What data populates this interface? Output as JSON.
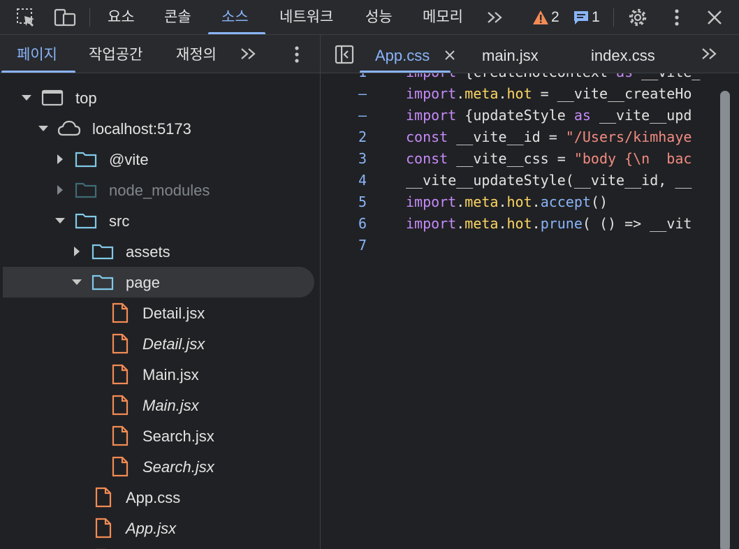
{
  "toolbar": {
    "tabs": [
      "요소",
      "콘솔",
      "소스",
      "네트워크",
      "성능",
      "메모리"
    ],
    "active_tab": "소스",
    "more_icon": "chevron-double-right",
    "warning_count": "2",
    "message_count": "1",
    "colors": {
      "accent": "#8ab4f8",
      "warning": "#f28b54"
    }
  },
  "navigator": {
    "tabs": [
      "페이지",
      "작업공간",
      "재정의"
    ],
    "active_tab": "페이지",
    "tree": [
      {
        "label": "top",
        "type": "frame",
        "expanded": true
      },
      {
        "label": "localhost:5173",
        "type": "cloud",
        "expanded": true
      },
      {
        "label": "@vite",
        "type": "folder",
        "expanded": false
      },
      {
        "label": "node_modules",
        "type": "folder",
        "expanded": false,
        "dimmed": true
      },
      {
        "label": "src",
        "type": "folder",
        "expanded": true
      },
      {
        "label": "assets",
        "type": "folder",
        "expanded": false
      },
      {
        "label": "page",
        "type": "folder",
        "expanded": true,
        "selected": true
      },
      {
        "label": "Detail.jsx",
        "type": "file"
      },
      {
        "label": "Detail.jsx",
        "type": "file",
        "italic": true
      },
      {
        "label": "Main.jsx",
        "type": "file"
      },
      {
        "label": "Main.jsx",
        "type": "file",
        "italic": true
      },
      {
        "label": "Search.jsx",
        "type": "file"
      },
      {
        "label": "Search.jsx",
        "type": "file",
        "italic": true
      },
      {
        "label": "App.css",
        "type": "file"
      },
      {
        "label": "App.jsx",
        "type": "file",
        "italic": true
      }
    ]
  },
  "editor": {
    "tabs": [
      "App.css",
      "main.jsx",
      "index.css"
    ],
    "active_tab": "App.css",
    "lines": [
      {
        "num": "1",
        "text": "import {createHotContext as __vite_"
      },
      {
        "num": "–",
        "text": "import.meta.hot = __vite__createHo"
      },
      {
        "num": "–",
        "text": "import {updateStyle as __vite__upd"
      },
      {
        "num": "2",
        "text": "const __vite__id = \"/Users/kimhaye"
      },
      {
        "num": "3",
        "text": "const __vite__css = \"body {\\n  bac"
      },
      {
        "num": "4",
        "text": "__vite__updateStyle(__vite__id, __"
      },
      {
        "num": "5",
        "text": "import.meta.hot.accept()"
      },
      {
        "num": "6",
        "text": "import.meta.hot.prune( () => __vit"
      },
      {
        "num": "7",
        "text": ""
      }
    ]
  }
}
